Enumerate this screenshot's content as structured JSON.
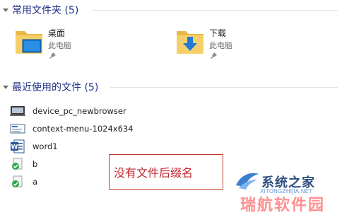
{
  "frequent_folders": {
    "title": "常用文件夹 (5)",
    "items": [
      {
        "name": "桌面",
        "location": "此电脑",
        "icon": "desktop-folder-icon"
      },
      {
        "name": "下载",
        "location": "此电脑",
        "icon": "downloads-folder-icon"
      }
    ]
  },
  "recent_files": {
    "title": "最近使用的文件 (5)",
    "items": [
      {
        "name": "device_pc_newbrowser",
        "icon": "image-file-icon"
      },
      {
        "name": "context-menu-1024x634",
        "icon": "image-file-icon"
      },
      {
        "name": "word1",
        "icon": "word-document-icon"
      },
      {
        "name": "b",
        "icon": "generic-file-icon"
      },
      {
        "name": "a",
        "icon": "generic-file-icon"
      }
    ]
  },
  "annotation": {
    "text": "没有文件后缀名",
    "color": "#c0272d"
  },
  "watermark": {
    "title": "系统之家",
    "url": "XITONGZHIJIA.NET",
    "overlay": "瑞航软件园"
  },
  "colors": {
    "section_title": "#1e3287",
    "subtext": "#6d6d6d"
  }
}
